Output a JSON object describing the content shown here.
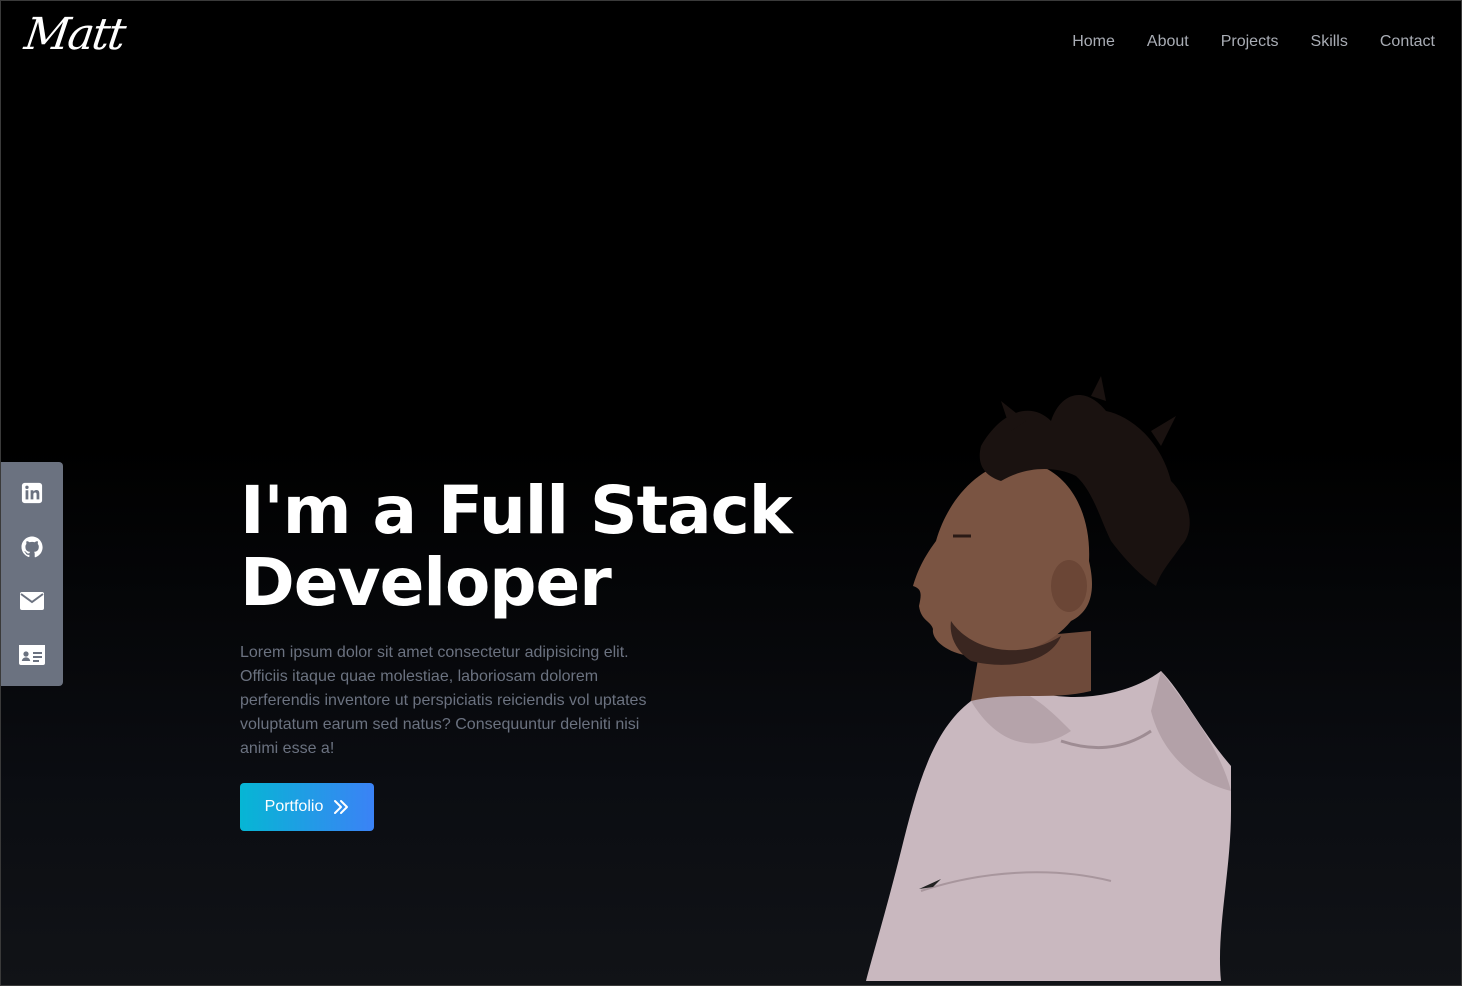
{
  "brand": {
    "logo_text": "Matt"
  },
  "nav": {
    "items": [
      {
        "label": "Home"
      },
      {
        "label": "About"
      },
      {
        "label": "Projects"
      },
      {
        "label": "Skills"
      },
      {
        "label": "Contact"
      }
    ]
  },
  "social": {
    "items": [
      {
        "icon": "linkedin-icon"
      },
      {
        "icon": "github-icon"
      },
      {
        "icon": "mail-icon"
      },
      {
        "icon": "resume-card-icon"
      }
    ]
  },
  "hero": {
    "title_line1": "I'm a Full Stack",
    "title_line2": "Developer",
    "description": "Lorem ipsum dolor sit amet consectetur adipisicing elit. Officiis itaque quae molestiae, laboriosam dolorem perferendis inventore ut perspiciatis reiciendis vol uptates voluptatum earum sed natus? Consequuntur deleniti nisi animi esse a!",
    "cta_label": "Portfolio",
    "cta_icon": "chevrons-right-icon"
  },
  "colors": {
    "background": "#000000",
    "nav_text": "#a9adb5",
    "sidebar": "#6b7280",
    "button_gradient_start": "#06b6d4",
    "button_gradient_end": "#3b82f6"
  }
}
